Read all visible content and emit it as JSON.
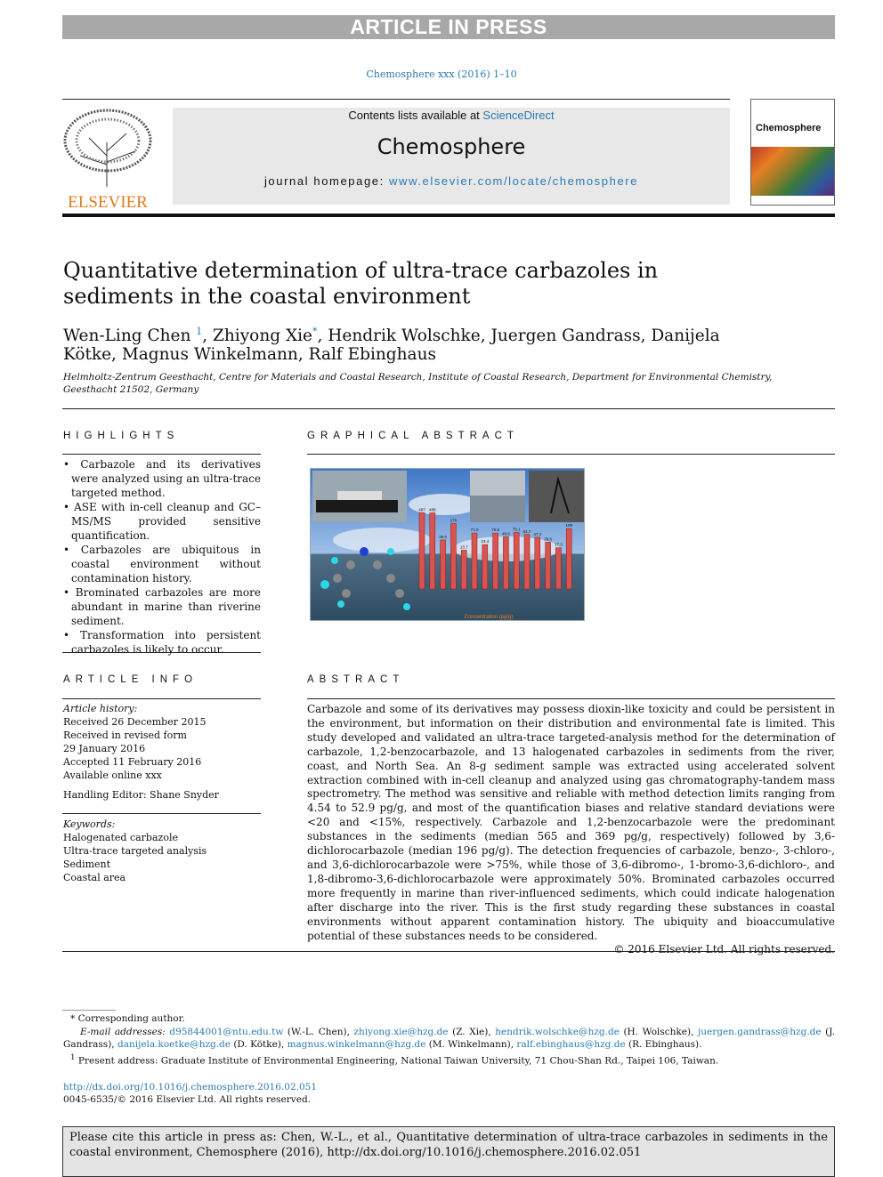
{
  "banner": "ARTICLE IN PRESS",
  "journal_ref": "Chemosphere xxx (2016) 1–10",
  "header": {
    "contents_prefix": "Contents lists available at ",
    "contents_link": "ScienceDirect",
    "journal": "Chemosphere",
    "homepage_prefix": "journal homepage: ",
    "homepage_link": "www.elsevier.com/locate/chemosphere",
    "publisher": "ELSEVIER",
    "cover_title": "Chemosphere"
  },
  "title": "Quantitative determination of ultra-trace carbazoles in sediments in the coastal environment",
  "authors": {
    "a1": "Wen-Ling Chen ",
    "a1_sup": "1",
    "a2": ", Zhiyong Xie",
    "a2_sup": "*",
    "rest": ", Hendrik Wolschke, Juergen Gandrass, Danijela Kötke, Magnus Winkelmann, Ralf Ebinghaus"
  },
  "affiliation": "Helmholtz-Zentrum Geesthacht, Centre for Materials and Coastal Research, Institute of Coastal Research, Department for Environmental Chemistry, Geesthacht 21502, Germany",
  "highlights": {
    "heading": "HIGHLIGHTS",
    "items": [
      "• Carbazole and its derivatives were analyzed using an ultra-trace targeted method.",
      "• ASE with in-cell cleanup and GC–MS/MS provided sensitive quantification.",
      "• Carbazoles are ubiquitous in coastal environment without contamination history.",
      "• Brominated carbazoles are more abundant in marine than riverine sediment.",
      "• Transformation into persistent carbazoles is likely to occur."
    ]
  },
  "graphical_abstract": {
    "heading": "GRAPHICAL ABSTRACT",
    "bar_labels": [
      "497",
      "488",
      "36.6",
      "176",
      "13.7",
      "71.0",
      "23.4",
      "70.6",
      "49.6",
      "75.1",
      "61.7",
      "47.4",
      "29.6",
      "17.3",
      "108"
    ],
    "bar_values": [
      497,
      488,
      36.6,
      176,
      13.7,
      71.0,
      23.4,
      70.6,
      49.6,
      75.1,
      61.7,
      47.4,
      29.6,
      17.3,
      108
    ],
    "bar_color": "#d9534f",
    "x_caption": "Concentration (pg/g)"
  },
  "article_info": {
    "heading": "ARTICLE INFO",
    "history_label": "Article history:",
    "history": [
      "Received 26 December 2015",
      "Received in revised form",
      "29 January 2016",
      "Accepted 11 February 2016",
      "Available online xxx"
    ],
    "editor": "Handling Editor: Shane Snyder",
    "keywords_label": "Keywords:",
    "keywords": [
      "Halogenated carbazole",
      "Ultra-trace targeted analysis",
      "Sediment",
      "Coastal area"
    ]
  },
  "abstract": {
    "heading": "ABSTRACT",
    "text": "Carbazole and some of its derivatives may possess dioxin-like toxicity and could be persistent in the environment, but information on their distribution and environmental fate is limited. This study developed and validated an ultra-trace targeted-analysis method for the determination of carbazole, 1,2-benzocarbazole, and 13 halogenated carbazoles in sediments from the river, coast, and North Sea. An 8-g sediment sample was extracted using accelerated solvent extraction combined with in-cell cleanup and analyzed using gas chromatography-tandem mass spectrometry. The method was sensitive and reliable with method detection limits ranging from 4.54 to 52.9 pg/g, and most of the quantification biases and relative standard deviations were <20 and <15%, respectively. Carbazole and 1,2-benzocarbazole were the predominant substances in the sediments (median 565 and 369 pg/g, respectively) followed by 3,6-dichlorocarbazole (median 196 pg/g). The detection frequencies of carbazole, benzo-, 3-chloro-, and 3,6-dichlorocarbazole were >75%, while those of 3,6-dibromo-, 1-bromo-3,6-dichloro-, and 1,8-dibromo-3,6-dichlorocarbazole were approximately 50%. Brominated carbazoles occurred more frequently in marine than river-influenced sediments, which could indicate halogenation after discharge into the river. This is the first study regarding these substances in coastal environments without apparent contamination history. The ubiquity and bioaccumulative potential of these substances needs to be considered.",
    "copyright": "© 2016 Elsevier Ltd. All rights reserved."
  },
  "footnotes": {
    "corr": "* Corresponding author.",
    "email_label": "E-mail addresses: ",
    "emails": [
      {
        "addr": "d95844001@ntu.edu.tw",
        "name": " (W.-L. Chen), "
      },
      {
        "addr": "zhiyong.xie@hzg.de",
        "name": " (Z. Xie), "
      },
      {
        "addr": "hendrik.wolschke@hzg.de",
        "name": " (H. Wolschke), "
      },
      {
        "addr": "juergen.gandrass@hzg.de",
        "name": " (J. Gandrass), "
      },
      {
        "addr": "danijela.koetke@hzg.de",
        "name": " (D. Kötke), "
      },
      {
        "addr": "magnus.winkelmann@hzg.de",
        "name": " (M. Winkelmann), "
      },
      {
        "addr": "ralf.ebinghaus@hzg.de",
        "name": " (R. Ebinghaus)."
      }
    ],
    "present_sup": "1",
    "present": "Present address: Graduate Institute of Environmental Engineering, National Taiwan University, 71 Chou-Shan Rd., Taipei 106, Taiwan.",
    "doi": "http://dx.doi.org/10.1016/j.chemosphere.2016.02.051",
    "issn": "0045-6535/© 2016 Elsevier Ltd. All rights reserved."
  },
  "citation": "Please cite this article in press as: Chen, W.-L., et al., Quantitative determination of ultra-trace carbazoles in sediments in the coastal environment, Chemosphere (2016), http://dx.doi.org/10.1016/j.chemosphere.2016.02.051"
}
